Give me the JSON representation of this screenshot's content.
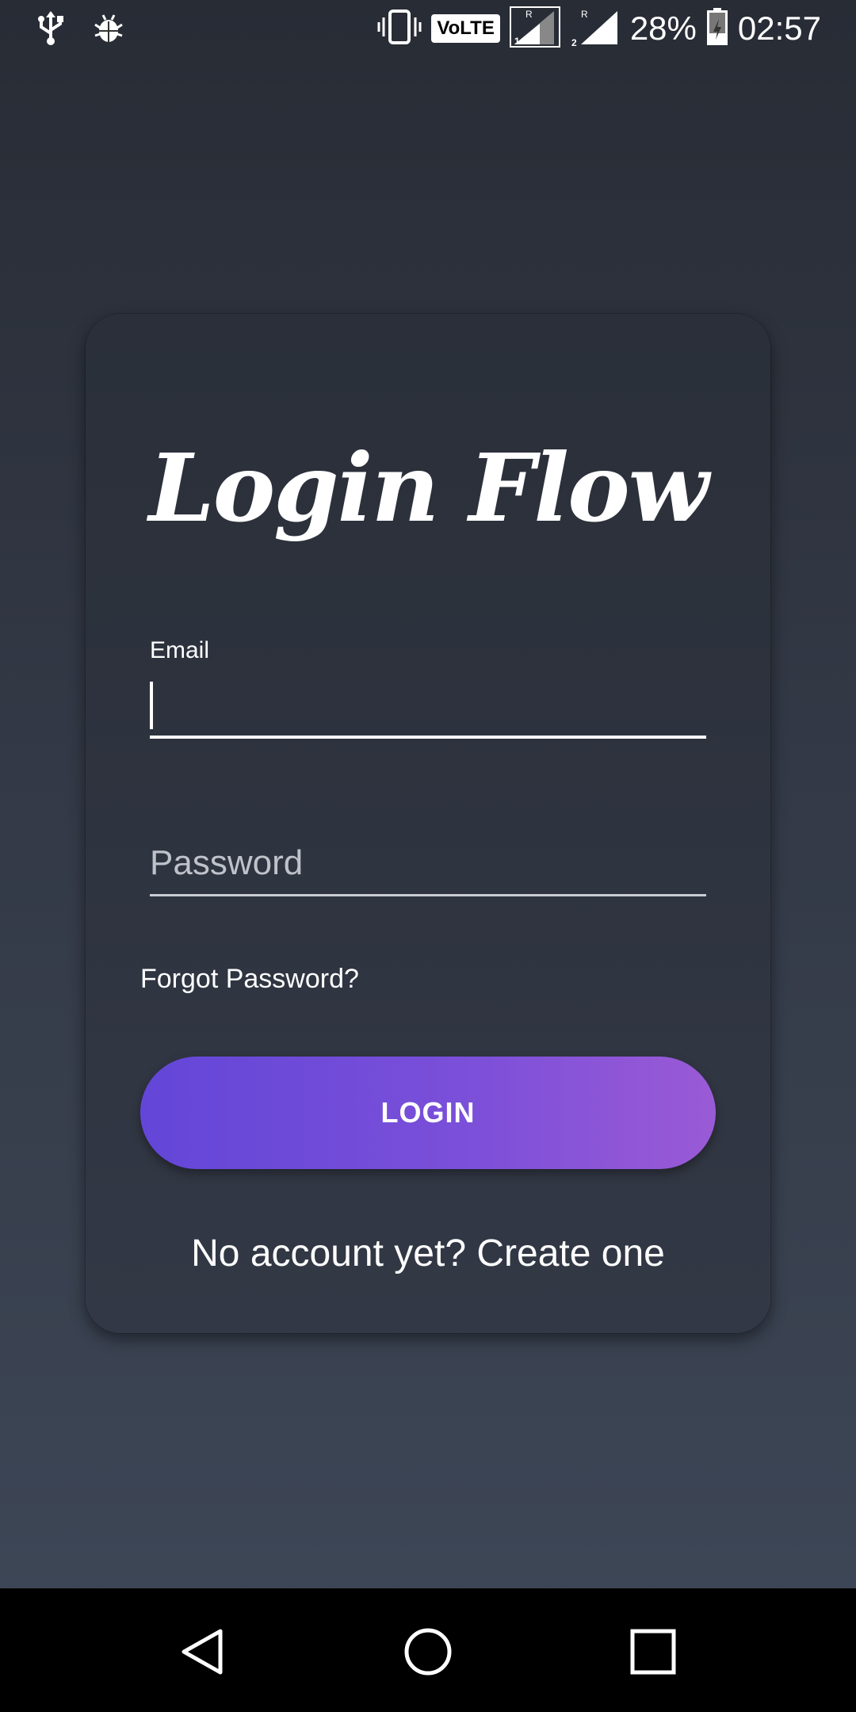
{
  "status_bar": {
    "left_icons": [
      "usb-icon",
      "bug-icon"
    ],
    "right_icons": [
      "vibrate-icon",
      "volte-badge",
      "sim1-signal-icon",
      "sim2-signal-icon",
      "battery-icon"
    ],
    "volte": "VoLTE",
    "battery_percent": "28%",
    "time": "02:57"
  },
  "card": {
    "title": "Login Flow",
    "email_label": "Email",
    "email_value": "",
    "password_placeholder": "Password",
    "forgot_password": "Forgot Password?",
    "login_button": "LOGIN",
    "create_account": "No account yet? Create one"
  },
  "nav_bar": {
    "buttons": [
      "back-icon",
      "home-icon",
      "recents-icon"
    ]
  },
  "colors": {
    "background_top": "#282c35",
    "background_bottom": "#3e4858",
    "button_start": "#6346d8",
    "button_end": "#9a5ad6"
  }
}
